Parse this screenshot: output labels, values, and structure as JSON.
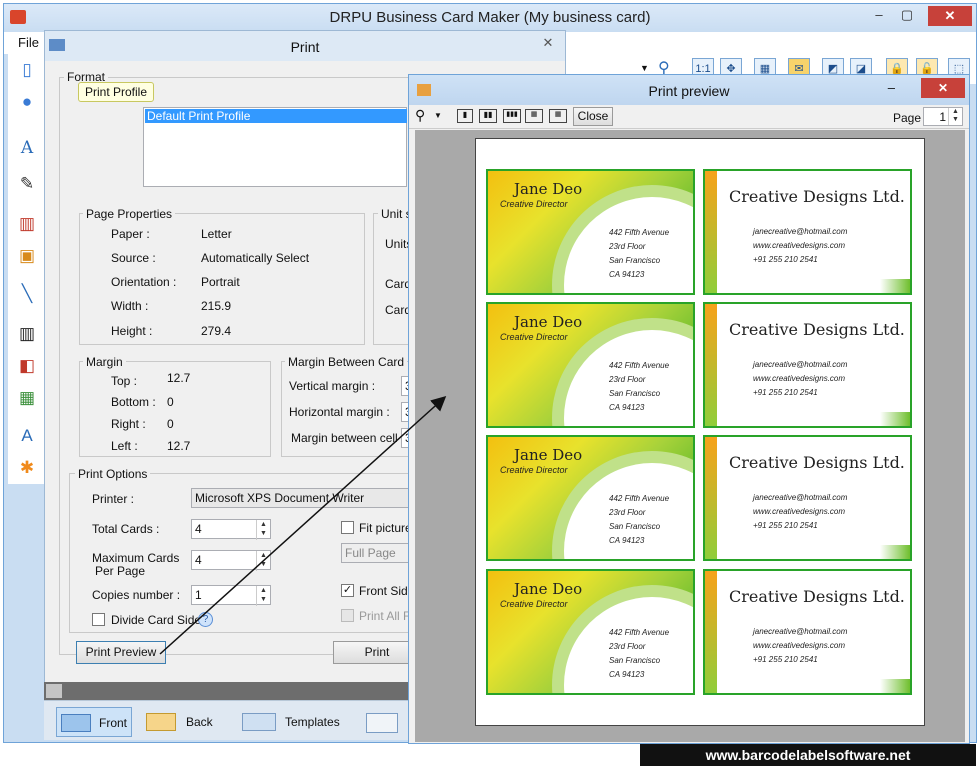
{
  "app": {
    "title": "DRPU Business Card Maker (My business card)",
    "menu_file": "File"
  },
  "window_controls": {
    "minimize": "–",
    "maximize": "▢",
    "close": "✕"
  },
  "print_dialog": {
    "title": "Print",
    "close": "✕",
    "format_label": "Format",
    "tooltip": "Print Profile",
    "profile_selected": "Default Print Profile",
    "page_properties": {
      "label": "Page Properties",
      "rows": [
        {
          "k": "Paper :",
          "v": "Letter"
        },
        {
          "k": "Source :",
          "v": "Automatically Select"
        },
        {
          "k": "Orientation :",
          "v": "Portrait"
        },
        {
          "k": "Width :",
          "v": "215.9"
        },
        {
          "k": "Height :",
          "v": "279.4"
        }
      ]
    },
    "unit": {
      "label": "Unit s",
      "units": "Units",
      "card1": "Card",
      "card2": "Card"
    },
    "margin": {
      "label": "Margin",
      "rows": [
        {
          "k": "Top :",
          "v": "12.7"
        },
        {
          "k": "Bottom :",
          "v": "0"
        },
        {
          "k": "Right :",
          "v": "0"
        },
        {
          "k": "Left :",
          "v": "12.7"
        }
      ]
    },
    "margin_between": {
      "label": "Margin Between Card",
      "vertical": "Vertical margin :",
      "horizontal": "Horizontal margin :",
      "between_cell": "Margin between cell :",
      "v1": "3",
      "v2": "3",
      "v3": "3"
    },
    "print_options": {
      "label": "Print Options",
      "printer_label": "Printer :",
      "printer_value": "Microsoft XPS Document Writer",
      "total_cards_label": "Total Cards :",
      "total_cards": "4",
      "max_cards_label_1": "Maximum Cards",
      "max_cards_label_2": "Per Page",
      "max_cards": "4",
      "copies_label": "Copies number :",
      "copies": "1",
      "divide_label": "Divide Card Side",
      "fit_picture": "Fit picture",
      "full_page": "Full Page",
      "front_side": "Front Side",
      "print_all": "Print All Fr",
      "help": "?"
    },
    "print_preview_button": "Print Preview",
    "print_button": "Print"
  },
  "bottom_tabs": {
    "front": "Front",
    "back": "Back",
    "templates": "Templates"
  },
  "preview": {
    "title": "Print preview",
    "close_button": "Close",
    "page_label": "Page",
    "page_value": "1",
    "close": "✕",
    "minimize": "–"
  },
  "card": {
    "name": "Jane Deo",
    "role": "Creative Director",
    "addr1": "442 Fifth Avenue",
    "addr2": "23rd Floor",
    "addr3": "San Francisco",
    "addr4": "CA 94123",
    "company": "Creative Designs Ltd.",
    "email": "janecreative@hotmail.com",
    "web": "www.creativedesigns.com",
    "phone": "+91 255 210 2541"
  },
  "watermark": "www.barcodelabelsoftware.net"
}
